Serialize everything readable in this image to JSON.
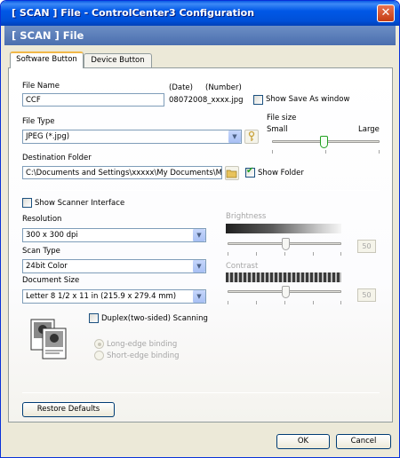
{
  "window": {
    "title": "[  SCAN  ]   File - ControlCenter3 Configuration",
    "close": "✕"
  },
  "header": {
    "title": "[  SCAN  ]   File"
  },
  "tabs": [
    {
      "label": "Software Button"
    },
    {
      "label": "Device Button"
    }
  ],
  "file_name": {
    "label": "File Name",
    "value": "CCF",
    "date_label": "(Date)",
    "number_label": "(Number)",
    "suffix": "08072008_xxxx.jpg"
  },
  "show_save_as": {
    "label": "Show Save As window",
    "checked": false
  },
  "file_type": {
    "label": "File Type",
    "value": "JPEG (*.jpg)"
  },
  "file_size": {
    "label": "File size",
    "small": "Small",
    "large": "Large"
  },
  "destination": {
    "label": "Destination Folder",
    "value": "C:\\Documents and Settings\\xxxxx\\My Documents\\My"
  },
  "show_folder": {
    "label": "Show Folder",
    "checked": true
  },
  "show_scanner": {
    "label": "Show Scanner Interface",
    "checked": false
  },
  "resolution": {
    "label": "Resolution",
    "value": "300 x 300 dpi"
  },
  "scan_type": {
    "label": "Scan Type",
    "value": "24bit Color"
  },
  "document_size": {
    "label": "Document Size",
    "value": "Letter 8 1/2 x 11 in (215.9 x 279.4 mm)"
  },
  "brightness": {
    "label": "Brightness",
    "value": "50"
  },
  "contrast": {
    "label": "Contrast",
    "value": "50"
  },
  "duplex": {
    "label": "Duplex(two-sided) Scanning",
    "checked": false
  },
  "binding": {
    "long": "Long-edge binding",
    "short": "Short-edge binding"
  },
  "restore_label": "Restore Defaults",
  "footer": {
    "ok": "OK",
    "cancel": "Cancel"
  },
  "colors": {
    "titlebar": "#0054e3",
    "header": "#5b7fbd",
    "check_green": "#21a121"
  }
}
